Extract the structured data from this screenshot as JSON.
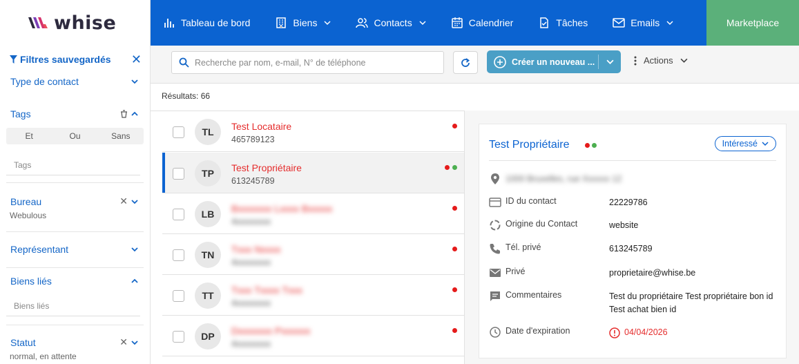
{
  "brand": {
    "name": "whise"
  },
  "sidebar": {
    "title": "Filtres sauvegardés",
    "filters": {
      "type_contact": "Type de contact",
      "tags": "Tags",
      "tags_modes": [
        "Et",
        "Ou",
        "Sans"
      ],
      "tags_placeholder": "Tags",
      "bureau": "Bureau",
      "bureau_value": "Webulous",
      "representant": "Représentant",
      "biens_lies": "Biens liés",
      "biens_lies_placeholder": "Biens liés",
      "statut": "Statut",
      "statut_value": "normal, en attente"
    }
  },
  "nav": {
    "items": [
      {
        "label": "Tableau de bord",
        "icon": "chart-bars-icon",
        "dropdown": false
      },
      {
        "label": "Biens",
        "icon": "building-icon",
        "dropdown": true
      },
      {
        "label": "Contacts",
        "icon": "users-icon",
        "dropdown": true
      },
      {
        "label": "Calendrier",
        "icon": "calendar-icon",
        "dropdown": false
      },
      {
        "label": "Tâches",
        "icon": "task-icon",
        "dropdown": false
      },
      {
        "label": "Emails",
        "icon": "mail-icon",
        "dropdown": true
      }
    ],
    "marketplace": "Marketplace"
  },
  "toolbar": {
    "search_placeholder": "Recherche par nom, e-mail, N° de téléphone",
    "create_label": "Créer un nouveau ...",
    "actions_label": "Actions"
  },
  "results": {
    "label": "Résultats:",
    "count": "66"
  },
  "list": [
    {
      "initials": "TL",
      "name": "Test Locataire",
      "phone": "465789123",
      "dots": [
        "#e51b1b"
      ],
      "blurred": false,
      "selected": false
    },
    {
      "initials": "TP",
      "name": "Test Propriétaire",
      "phone": "613245789",
      "dots": [
        "#e51b1b",
        "#4caf50"
      ],
      "blurred": false,
      "selected": true
    },
    {
      "initials": "LB",
      "name": "Bxxxxxxx Lxxxx Bxxxxx",
      "phone": "4xxxxxxxx",
      "dots": [
        "#e51b1b"
      ],
      "blurred": true,
      "selected": false
    },
    {
      "initials": "TN",
      "name": "Txxx Nxxxx",
      "phone": "4xxxxxxxx",
      "dots": [
        "#e51b1b"
      ],
      "blurred": true,
      "selected": false
    },
    {
      "initials": "TT",
      "name": "Txxx Txxxx Txxx",
      "phone": "4xxxxxxxx",
      "dots": [
        "#e51b1b"
      ],
      "blurred": true,
      "selected": false
    },
    {
      "initials": "DP",
      "name": "Dxxxxxxx Pxxxxxx",
      "phone": "4xxxxxxxx",
      "dots": [
        "#e51b1b"
      ],
      "blurred": true,
      "selected": false
    }
  ],
  "detail": {
    "title": "Test Propriétaire",
    "status": "Intéressé",
    "address": "1000 Bruxelles, rue Xxxxxx 12",
    "fields": [
      {
        "icon": "id-card-icon",
        "label": "ID du contact",
        "value": "22229786"
      },
      {
        "icon": "origin-icon",
        "label": "Origine du Contact",
        "value": "website"
      },
      {
        "icon": "phone-icon",
        "label": "Tél. privé",
        "value": "613245789"
      },
      {
        "icon": "envelope-icon",
        "label": "Privé",
        "value": "proprietaire@whise.be"
      },
      {
        "icon": "comment-icon",
        "label": "Commentaires",
        "value": "Test du propriétaire Test propriétaire bon id Test achat bien id"
      },
      {
        "icon": "clock-icon",
        "label": "Date d'expiration",
        "value": "04/04/2026"
      }
    ]
  },
  "colors": {
    "primary": "#0b63d1",
    "marketplace": "#5bb07a",
    "create": "#4a9fc6",
    "alert": "#e52d2d"
  }
}
